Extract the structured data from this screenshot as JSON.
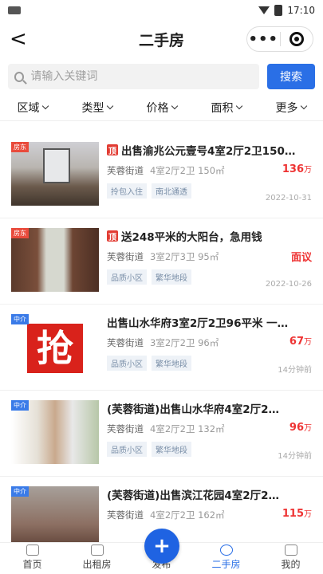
{
  "status": {
    "time": "17:10"
  },
  "nav": {
    "title": "二手房",
    "back": "<",
    "more": "•••"
  },
  "search": {
    "placeholder": "请输入关键词",
    "button": "搜索"
  },
  "filters": [
    "区域",
    "类型",
    "价格",
    "面积",
    "更多"
  ],
  "listings": [
    {
      "tag": "房东",
      "tag_color": "red",
      "ding": "顶",
      "title": "出售渝兆公元壹号4室2厅2卫150…",
      "area": "芙蓉街道",
      "spec": "4室2厅2卫 150㎡",
      "price": "136",
      "unit": "万",
      "chips": [
        "拎包入住",
        "南北通透"
      ],
      "time": "2022-10-31",
      "art": "art1"
    },
    {
      "tag": "房东",
      "tag_color": "red",
      "ding": "顶",
      "title": "送248平米的大阳台，急用钱",
      "area": "芙蓉街道",
      "spec": "3室2厅3卫 95㎡",
      "price": "面议",
      "unit": "",
      "chips": [
        "品质小区",
        "繁华地段"
      ],
      "time": "2022-10-26",
      "art": "art2"
    },
    {
      "tag": "中介",
      "tag_color": "blue",
      "ding": "",
      "title": "出售山水华府3室2厅2卫96平米 一…",
      "area": "芙蓉街道",
      "spec": "3室2厅2卫 96㎡",
      "price": "67",
      "unit": "万",
      "chips": [
        "品质小区",
        "繁华地段"
      ],
      "time": "14分钟前",
      "art": "art3",
      "art_text": "抢"
    },
    {
      "tag": "中介",
      "tag_color": "blue",
      "ding": "",
      "title": "(芙蓉街道)出售山水华府4室2厅2…",
      "area": "芙蓉街道",
      "spec": "4室2厅2卫 132㎡",
      "price": "96",
      "unit": "万",
      "chips": [
        "品质小区",
        "繁华地段"
      ],
      "time": "14分钟前",
      "art": "art4"
    },
    {
      "tag": "中介",
      "tag_color": "blue",
      "ding": "",
      "title": "(芙蓉街道)出售滨江花园4室2厅2…",
      "area": "芙蓉街道",
      "spec": "4室2厅2卫 162㎡",
      "price": "115",
      "unit": "万",
      "chips": [],
      "time": "",
      "art": "art5"
    }
  ],
  "tabbar": [
    {
      "label": "首页",
      "active": false
    },
    {
      "label": "出租房",
      "active": false
    },
    {
      "label": "发布",
      "active": false
    },
    {
      "label": "二手房",
      "active": true
    },
    {
      "label": "我的",
      "active": false
    }
  ],
  "fab": "+",
  "colors": {
    "accent": "#2a6fe6",
    "price": "#e33333",
    "tag_red": "#e94b3c",
    "tag_blue": "#3a7be8"
  }
}
